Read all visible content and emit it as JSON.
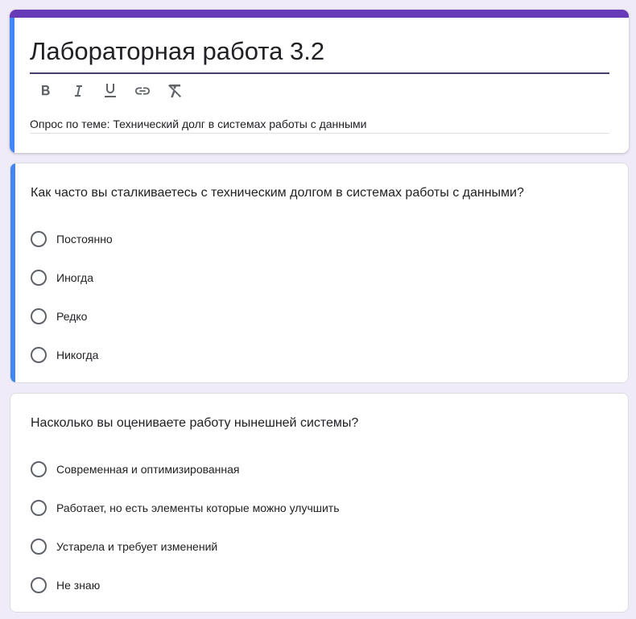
{
  "colors": {
    "theme": "#673ab7",
    "focus_accent": "#4285f4",
    "background": "#f0ebf8"
  },
  "header": {
    "title": "Лабораторная работа 3.2",
    "description": "Опрос по теме: Технический долг в системах работы с данными",
    "toolbar": [
      "bold-icon",
      "italic-icon",
      "underline-icon",
      "link-icon",
      "clear-format-icon"
    ]
  },
  "questions": [
    {
      "text": "Как часто вы сталкиваетесь с техническим долгом в системах работы с данными?",
      "options": [
        "Постоянно",
        "Иногда",
        "Редко",
        "Никогда"
      ]
    },
    {
      "text": "Насколько вы оцениваете работу нынешней системы?",
      "options": [
        "Современная и оптимизированная",
        "Работает, но есть элементы которые можно улучшить",
        "Устарела и требует изменений",
        "Не знаю"
      ]
    }
  ]
}
